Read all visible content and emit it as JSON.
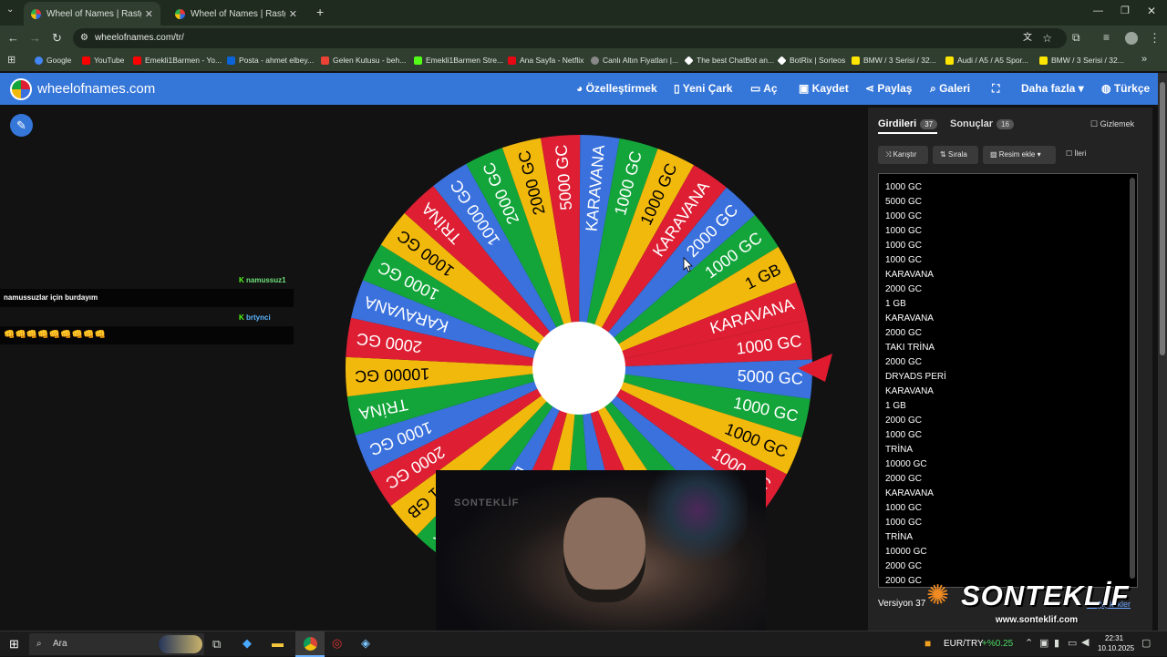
{
  "browser": {
    "tabs": [
      {
        "title": "Wheel of Names | Rastgele ad"
      },
      {
        "title": "Wheel of Names | Rastgele ad"
      }
    ],
    "url": "wheelofnames.com/tr/",
    "bookmarks": [
      {
        "label": "Google",
        "color": "#4285f4"
      },
      {
        "label": "YouTube",
        "color": "#ff0000"
      },
      {
        "label": "Emekli1Barmen - Yo...",
        "color": "#ff0000"
      },
      {
        "label": "Posta - ahmet elbey...",
        "color": "#0a64d8"
      },
      {
        "label": "Gelen Kutusu - beh...",
        "color": "#ea4335"
      },
      {
        "label": "Emekli1Barmen Stre...",
        "color": "#53fc18"
      },
      {
        "label": "Ana Sayfa - Netflix",
        "color": "#e50914"
      },
      {
        "label": "Canlı Altın Fiyatları |...",
        "color": "#888888"
      },
      {
        "label": "The best ChatBot an...",
        "color": "#ffffff"
      },
      {
        "label": "BotRix | Sorteos",
        "color": "#ffffff"
      },
      {
        "label": "BMW / 3 Serisi / 32...",
        "color": "#ffe600"
      },
      {
        "label": "Audi / A5 / A5 Spor...",
        "color": "#ffe600"
      },
      {
        "label": "BMW / 3 Serisi / 32...",
        "color": "#ffe600"
      }
    ]
  },
  "app": {
    "brand": "wheelofnames.com",
    "nav": {
      "customize": "Özelleştirmek",
      "new_wheel": "Yeni Çark",
      "open": "Aç",
      "save": "Kaydet",
      "share": "Paylaş",
      "gallery": "Galeri",
      "more": "Daha fazla",
      "language": "Türkçe"
    }
  },
  "chat": {
    "user1": "namussuz1",
    "message1": "namussuzlar için burdayım",
    "user2": "brtynci",
    "emotes": "👊👊👊👊👊👊👊👊👊"
  },
  "wheel": {
    "colors": [
      "#dd1e33",
      "#3a71dd",
      "#13a53a",
      "#f2b90d"
    ],
    "labels": [
      "1000 GC",
      "5000 GC",
      "1000 GC",
      "1000 GC",
      "1000 GC",
      "1000 GC",
      "KARAVANA",
      "2000 GC",
      "1 GB",
      "KARAVANA",
      "2000 GC",
      "TAKI TRİNA",
      "2000 GC",
      "DRYADS PERİ",
      "KARAVANA",
      "1 GB",
      "2000 GC",
      "1000 GC",
      "TRİNA",
      "10000 GC",
      "2000 GC",
      "KARAVANA",
      "1000 GC",
      "1000 GC",
      "TRİNA",
      "10000 GC",
      "2000 GC",
      "2000 GC",
      "5000 GC",
      "KARAVANA",
      "1000 GC",
      "1000 GC",
      "KARAVANA",
      "2000 GC",
      "1000 GC",
      "1 GB",
      "KARAVANA"
    ]
  },
  "panel": {
    "tab_entries": "Girdileri",
    "entries_count": "37",
    "tab_results": "Sonuçlar",
    "results_count": "16",
    "hide": "Gizlemek",
    "shuffle": "Karıştır",
    "sort": "Sırala",
    "add_image": "Resim ekle",
    "advanced": "İleri",
    "entries": [
      "1000 GC",
      "5000 GC",
      "1000 GC",
      "1000 GC",
      "1000 GC",
      "1000 GC",
      "KARAVANA",
      "2000 GC",
      "1 GB",
      "KARAVANA",
      "2000 GC",
      "TAKI TRİNA",
      "2000 GC",
      "DRYADS PERİ",
      "KARAVANA",
      "1 GB",
      "2000 GC",
      "1000 GC",
      "TRİNA",
      "10000 GC",
      "2000 GC",
      "KARAVANA",
      "1000 GC",
      "1000 GC",
      "TRİNA",
      "10000 GC",
      "2000 GC",
      "2000 GC"
    ],
    "version": "Versiyon 37",
    "changes": "Değişiklikler"
  },
  "overlay": {
    "watermark": "SONTEKLİF",
    "site": "www.sonteklif.com",
    "cam_tag": "SONTEKLİF"
  },
  "taskbar": {
    "search": "Ara",
    "ticker": "EUR/TRY",
    "ticker_change": "+%0.25",
    "time": "22:31",
    "date": "10.10.2025"
  }
}
